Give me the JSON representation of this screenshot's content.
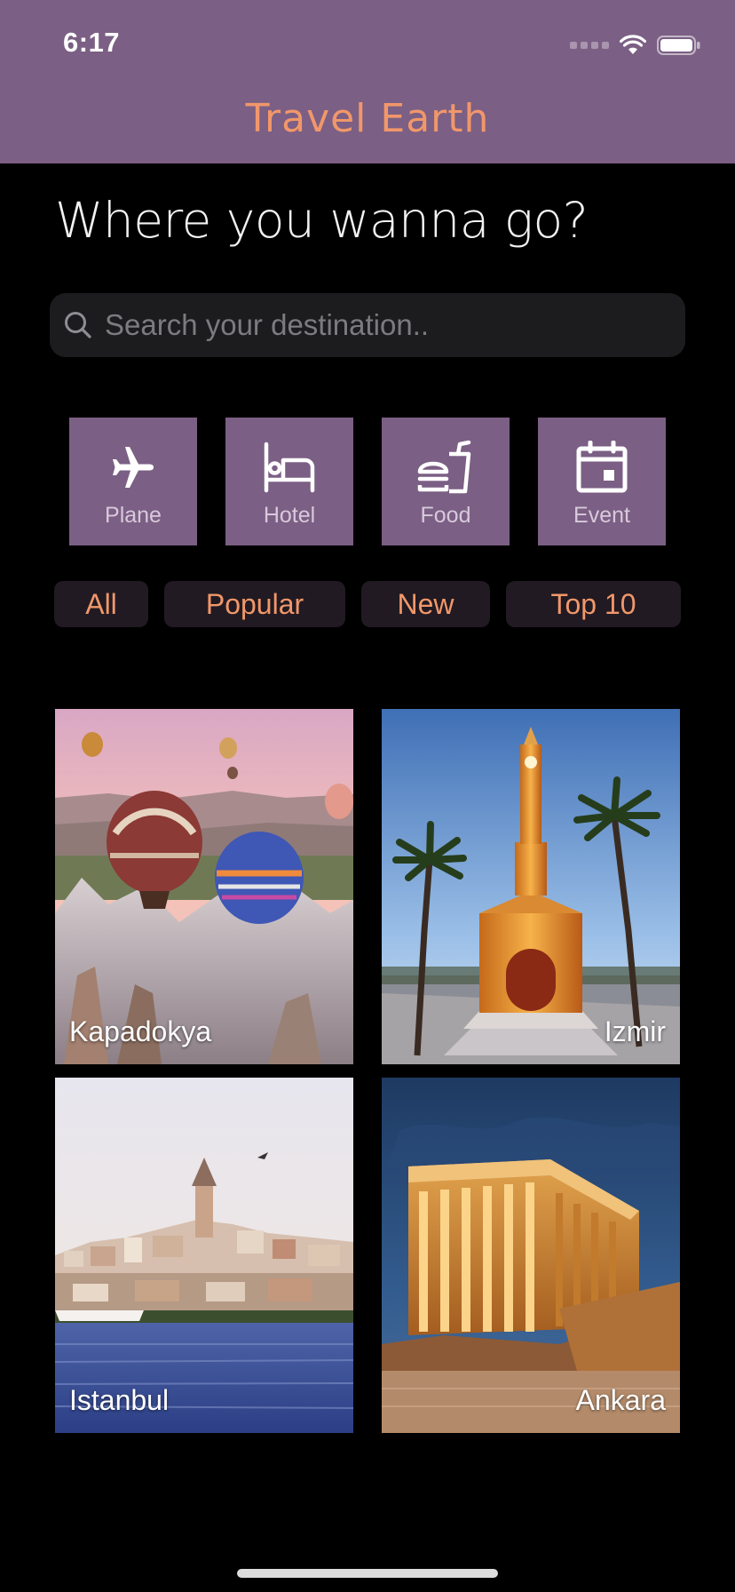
{
  "status_bar": {
    "time": "6:17"
  },
  "nav": {
    "title": "Travel Earth"
  },
  "heading": "Where you wanna go?",
  "search": {
    "placeholder": "Search your destination..",
    "value": ""
  },
  "categories": [
    {
      "label": "Plane",
      "icon": "airplane-icon"
    },
    {
      "label": "Hotel",
      "icon": "bed-icon"
    },
    {
      "label": "Food",
      "icon": "food-icon"
    },
    {
      "label": "Event",
      "icon": "calendar-icon"
    }
  ],
  "filters": [
    "All",
    "Popular",
    "New",
    "Top 10"
  ],
  "destinations": [
    {
      "name": "Kapadokya"
    },
    {
      "name": "Izmir"
    },
    {
      "name": "Istanbul"
    },
    {
      "name": "Ankara"
    }
  ],
  "colors": {
    "accent": "#f1976a",
    "brand": "#7b5f84",
    "background": "#000000"
  }
}
